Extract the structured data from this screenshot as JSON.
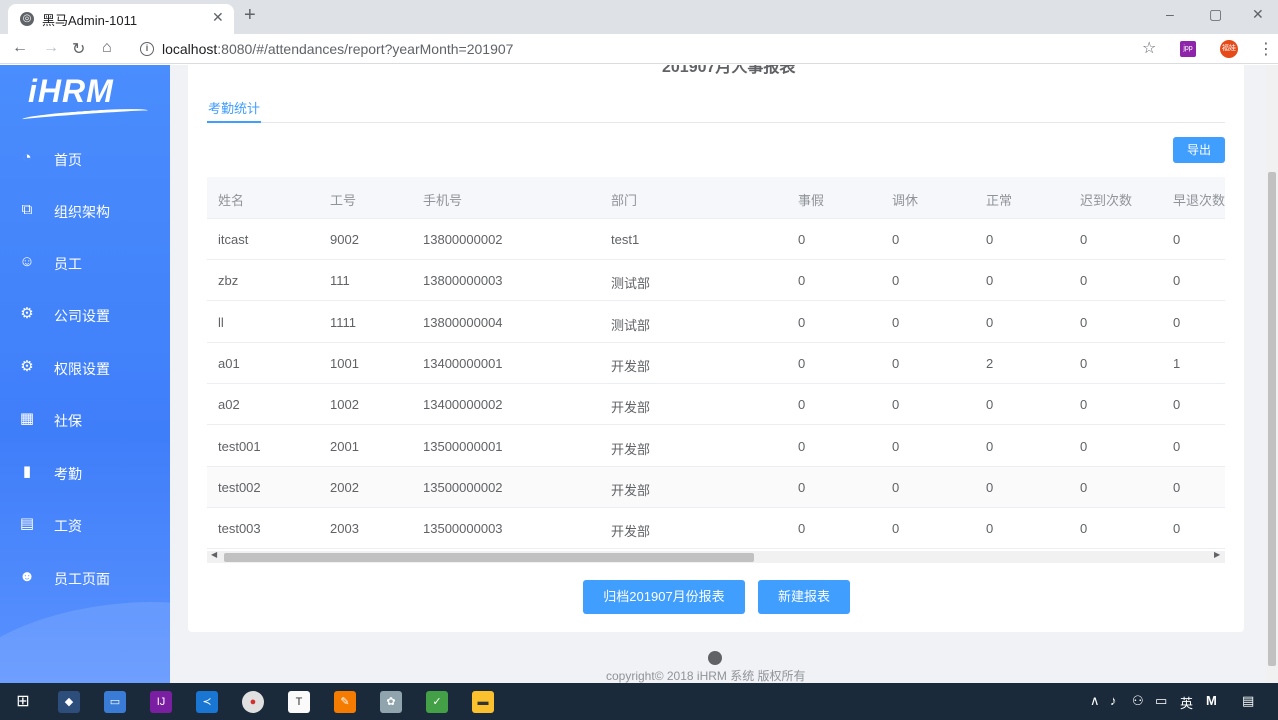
{
  "browser": {
    "tab_title": "黑马Admin-1011",
    "tab_close": "✕",
    "new_tab": "+",
    "url_host": "localhost",
    "url_rest": ":8080/#/attendances/report?yearMonth=201907",
    "window_controls": [
      "–",
      "▢",
      "✕"
    ],
    "ext1_label": "jpp",
    "ext2_label": "福娃"
  },
  "sidebar": {
    "logo": "iHRM",
    "items": [
      {
        "label": "首页",
        "icon": "dashboard-icon"
      },
      {
        "label": "组织架构",
        "icon": "org-tree-icon"
      },
      {
        "label": "员工",
        "icon": "user-icon"
      },
      {
        "label": "公司设置",
        "icon": "gear-icon"
      },
      {
        "label": "权限设置",
        "icon": "gear-icon"
      },
      {
        "label": "社保",
        "icon": "grid-icon"
      },
      {
        "label": "考勤",
        "icon": "book-icon"
      },
      {
        "label": "工资",
        "icon": "table-icon"
      },
      {
        "label": "员工页面",
        "icon": "users-icon"
      }
    ]
  },
  "main": {
    "page_title": "201907月人事报表",
    "tab_label": "考勤统计",
    "export_label": "导出",
    "columns": [
      "姓名",
      "工号",
      "手机号",
      "部门",
      "事假",
      "调休",
      "正常",
      "迟到次数",
      "早退次数"
    ],
    "rows": [
      [
        "itcast",
        "9002",
        "13800000002",
        "test1",
        "0",
        "0",
        "0",
        "0",
        "0"
      ],
      [
        "zbz",
        "111",
        "13800000003",
        "测试部",
        "0",
        "0",
        "0",
        "0",
        "0"
      ],
      [
        "ll",
        "1111",
        "13800000004",
        "测试部",
        "0",
        "0",
        "0",
        "0",
        "0"
      ],
      [
        "a01",
        "1001",
        "13400000001",
        "开发部",
        "0",
        "0",
        "2",
        "0",
        "1"
      ],
      [
        "a02",
        "1002",
        "13400000002",
        "开发部",
        "0",
        "0",
        "0",
        "0",
        "0"
      ],
      [
        "test001",
        "2001",
        "13500000001",
        "开发部",
        "0",
        "0",
        "0",
        "0",
        "0"
      ],
      [
        "test002",
        "2002",
        "13500000002",
        "开发部",
        "0",
        "0",
        "0",
        "0",
        "0"
      ],
      [
        "test003",
        "2003",
        "13500000003",
        "开发部",
        "0",
        "0",
        "0",
        "0",
        "0"
      ]
    ],
    "archive_label": "归档201907月份报表",
    "new_report_label": "新建报表",
    "copyright": "copyright© 2018 iHRM 系统 版权所有"
  },
  "taskbar": {
    "tray_ime": "英",
    "tray_m": "M"
  }
}
